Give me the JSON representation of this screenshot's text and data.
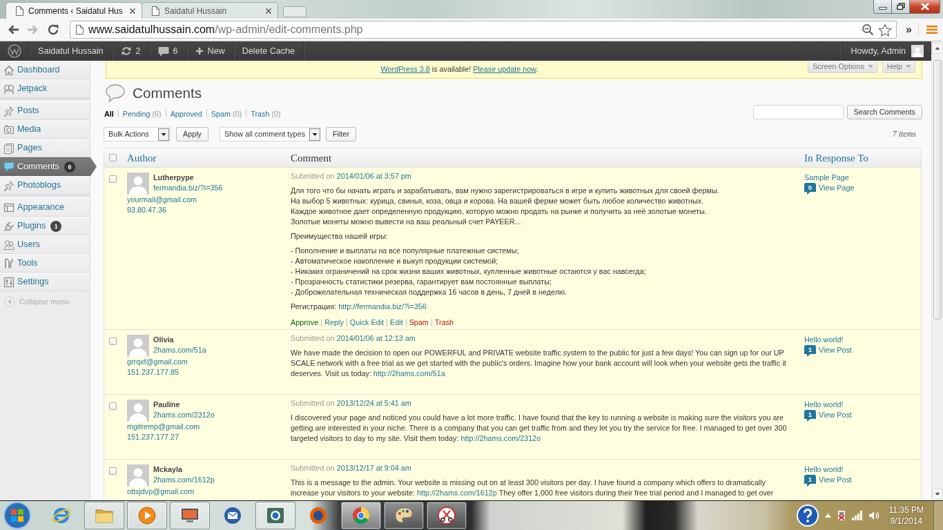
{
  "browser": {
    "tabs": [
      {
        "title": "Comments ‹ Saidatul Hus",
        "selected": true
      },
      {
        "title": "Saidatul Hussain",
        "selected": false
      }
    ],
    "history": {
      "back_disabled": false,
      "forward_disabled": true
    },
    "address": {
      "host": "www.saidatulhussain.com",
      "path": "/wp-admin/edit-comments.php"
    },
    "overflow": "»"
  },
  "admin_bar": {
    "site": "Saidatul Hussain",
    "updates": "2",
    "comments": "6",
    "new": "New",
    "items": [
      "Delete Cache"
    ],
    "account": "Howdy, Admin"
  },
  "sidebar": {
    "groups": [
      {
        "items": [
          {
            "label": "Dashboard",
            "selected": false
          },
          {
            "label": "Jetpack",
            "selected": false
          }
        ]
      },
      {
        "items": [
          {
            "label": "Posts",
            "selected": false
          },
          {
            "label": "Media",
            "selected": false
          },
          {
            "label": "Pages",
            "selected": false
          },
          {
            "label": "Comments",
            "selected": true,
            "badge": "6"
          },
          {
            "label": "Photoblogs",
            "selected": false
          }
        ]
      },
      {
        "items": [
          {
            "label": "Appearance",
            "selected": false
          },
          {
            "label": "Plugins",
            "selected": false,
            "badge": "1"
          },
          {
            "label": "Users",
            "selected": false
          },
          {
            "label": "Tools",
            "selected": false
          },
          {
            "label": "Settings",
            "selected": false
          }
        ]
      }
    ],
    "collapse": "Collapse menu"
  },
  "update_nag": {
    "version_link": "WordPress 3.8",
    "message": "is available!",
    "update_link": "Please update now",
    "end": "."
  },
  "screen_tabs": [
    "Screen Options",
    "Help"
  ],
  "title": "Comments",
  "filters": [
    {
      "label": "All",
      "selected": true
    },
    {
      "label": "Pending",
      "count": "(6)",
      "selected": false
    },
    {
      "label": "Approved",
      "selected": false
    },
    {
      "label": "Spam",
      "count": "(0)",
      "selected": false
    },
    {
      "label": "Trash",
      "count": "(0)",
      "selected": false
    }
  ],
  "search": {
    "button": "Search Comments"
  },
  "tablenav": {
    "bulk_action": "Bulk Actions",
    "apply": "Apply",
    "type_filter": "Show all comment types",
    "filter": "Filter",
    "count": "7 items"
  },
  "table": {
    "select_all": false,
    "columns": [
      {
        "label": "Author",
        "sortable": true
      },
      {
        "label": "Comment",
        "sortable": false
      },
      {
        "label": "In Response To",
        "sortable": true
      }
    ],
    "rows": [
      {
        "checked": false,
        "approved": false,
        "author": {
          "name": "Lutherpype",
          "url": "fermandia.biz/?i=356",
          "email": "yourmail@gmail.com",
          "ip": "93.80.47.36"
        },
        "submitted": {
          "prefix": "Submitted on",
          "date": "2014/01/06 at 3:57 pm"
        },
        "paragraphs": [
          {
            "lines": [
              "Для того что бы начать играть и зарабатывать, вам нужно зарегистрироваться в игре и купить животных для своей фермы.",
              "На выбор 5 животных: курица, свинья, коза, овца и корова. На вашей ферме может быть любое количество животных.",
              "Каждое животное дает определенную продукцию, которую можно продать на рынке и получить за неё золотые монеты.",
              "Золотые монеты можно вывести на ваш реальный счет PAYEER..."
            ]
          },
          {
            "lines": [
              "Преимущества нашей игры:"
            ]
          },
          {
            "lines": [
              "- Пополнение и выплаты на все популярные платежные системы;",
              "- Автоматическое накопление и выкуп продукции системой;",
              "- Никаких ограничений на срок жизни ваших животных, купленные животные остаются у вас навсегда;",
              "- Прозрачность статистики резерва, гарантирует вам постоянные выплаты;",
              "- Доброжелательная техническая поддержка 16 часов в день, 7 дней в неделю."
            ]
          },
          {
            "text": "Регистрация:",
            "link": "http://fermandia.biz/?i=356"
          }
        ],
        "actions": [
          {
            "label": "Approve",
            "kind": "approve"
          },
          {
            "label": "Reply",
            "kind": "normal"
          },
          {
            "label": "Quick Edit",
            "kind": "normal"
          },
          {
            "label": "Edit",
            "kind": "normal"
          },
          {
            "label": "Spam",
            "kind": "danger"
          },
          {
            "label": "Trash",
            "kind": "danger"
          }
        ],
        "response": {
          "title": "Sample Page",
          "count": "0",
          "view": "View Page"
        }
      },
      {
        "checked": false,
        "approved": false,
        "author": {
          "name": "Olivia",
          "url": "2hams.com/51a",
          "email": "grrqxf@gmail.com",
          "ip": "151.237.177.85"
        },
        "submitted": {
          "prefix": "Submitted on",
          "date": "2014/01/06 at 12:13 am"
        },
        "paragraphs": [
          {
            "text": "We have made the decision to open our POWERFUL and PRIVATE website traffic system to the public for just a few days! You can sign up for our UP SCALE network with a free trial as we get started with the public's orders. Imagine how your bank account will look when your website gets the traffic it deserves. Visit us today:",
            "link": "http://2hams.com/51a"
          }
        ],
        "response": {
          "title": "Hello world!",
          "count": "1",
          "view": "View Post"
        }
      },
      {
        "checked": false,
        "approved": false,
        "author": {
          "name": "Pauline",
          "url": "2hams.com/2312o",
          "email": "mgitremp@gmail.com",
          "ip": "151.237.177.27"
        },
        "submitted": {
          "prefix": "Submitted on",
          "date": "2013/12/24 at 5:41 am"
        },
        "paragraphs": [
          {
            "text": "I discovered your page and noticed you could have a lot more traffic. I have found that the key to running a website is making sure the visitors you are getting are interested in your niche. There is a company that you can get traffic from and they let you try the service for free. I managed to get over 300 targeted visitors to day to my site. Visit them today:",
            "link": "http://2hams.com/2312o"
          }
        ],
        "response": {
          "title": "Hello world!",
          "count": "1",
          "view": "View Post"
        }
      },
      {
        "checked": false,
        "approved": false,
        "author": {
          "name": "Mckayla",
          "url": "2hams.com/1612p",
          "email": "ottsjdvp@gmail.com"
        },
        "submitted": {
          "prefix": "Submitted on",
          "date": "2013/12/17 at 9:04 am"
        },
        "paragraphs": [
          {
            "text": "This is a message to the admin. Your website is missing out on at least 300 visitors per day. I have found a company which offers to dramatically increase your visitors to your website:",
            "link": "http://2hams.com/1612p",
            "after": "They offer 1,000 free visitors during their free trial period and I managed to get over"
          }
        ],
        "response": {
          "title": "Hello world!",
          "count": "1",
          "view": "View Post"
        }
      }
    ]
  },
  "taskbar": {
    "apps": [
      {
        "running": false,
        "active": false
      },
      {
        "running": true,
        "active": false
      },
      {
        "running": true,
        "active": false
      },
      {
        "running": true,
        "active": false
      },
      {
        "running": false,
        "active": false
      },
      {
        "running": true,
        "active": false
      },
      {
        "running": false,
        "active": false
      },
      {
        "running": true,
        "active": true
      },
      {
        "running": true,
        "active": false
      },
      {
        "running": true,
        "active": false
      }
    ],
    "clock": {
      "time": "11:35 PM",
      "date": "9/1/2014"
    }
  }
}
